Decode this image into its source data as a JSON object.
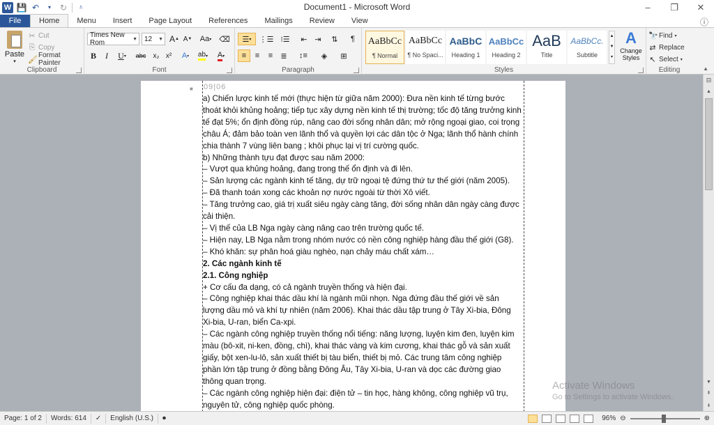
{
  "window": {
    "title": "Document1 - Microsoft Word",
    "app_letter": "W",
    "controls": [
      "–",
      "❐",
      "✕"
    ]
  },
  "tabs": {
    "file": "File",
    "items": [
      "Home",
      "Menu",
      "Insert",
      "Page Layout",
      "References",
      "Mailings",
      "Review",
      "View"
    ],
    "active": "Home"
  },
  "ribbon": {
    "clipboard": {
      "label": "Clipboard",
      "paste": "Paste",
      "cut": "Cut",
      "copy": "Copy",
      "format_painter": "Format Painter"
    },
    "font": {
      "label": "Font",
      "font_name": "Times New Rom",
      "font_size": "12",
      "bold": "B",
      "italic": "I",
      "underline": "U",
      "strike": "abc",
      "subscript": "x₂",
      "superscript": "x²",
      "grow": "A",
      "shrink": "A",
      "change_case": "Aa",
      "text_effects": "A",
      "highlight": "ab",
      "font_color": "A"
    },
    "paragraph": {
      "label": "Paragraph"
    },
    "styles": {
      "label": "Styles",
      "items": [
        {
          "preview": "AaBbCc",
          "name": "¶ Normal"
        },
        {
          "preview": "AaBbCc",
          "name": "¶ No Spaci..."
        },
        {
          "preview": "AaBbC",
          "name": "Heading 1"
        },
        {
          "preview": "AaBbCc",
          "name": "Heading 2"
        },
        {
          "preview": "AaB",
          "name": "Title"
        },
        {
          "preview": "AaBbCc.",
          "name": "Subtitle"
        }
      ],
      "change_styles": "Change Styles"
    },
    "editing": {
      "label": "Editing",
      "find": "Find",
      "replace": "Replace",
      "select": "Select"
    }
  },
  "document": {
    "ruler_marks": "09|06",
    "paragraphs": [
      {
        "text": "a) Chiến lược kinh tế mới (thực hiện từ giữa năm 2000): Đưa nền kinh tế từng bước",
        "bold": false
      },
      {
        "text": "thoát khỏi khủng hoảng; tiếp tục xây dựng nền kinh tế thị trường; tốc độ tăng trưởng kinh",
        "bold": false
      },
      {
        "text": "tế đạt 5%; ổn định đồng rúp, nâng cao đời sống nhân dân; mở rộng ngoại giao, coi trọng",
        "bold": false
      },
      {
        "text": "châu Á; đảm bảo toàn ven lãnh thổ và quyền lợi các dân tộc ở Nga; lãnh thổ hành chính",
        "bold": false
      },
      {
        "text": "chia thành 7 vùng liên bang ; khôi phục lại vị trí cường quốc.",
        "bold": false
      },
      {
        "text": "b) Những thành tựu đạt được sau năm 2000:",
        "bold": false
      },
      {
        "text": "– Vượt qua khủng hoảng, đang trong thế ổn định và đi lên.",
        "bold": false
      },
      {
        "text": "– Sản lượng các ngành kinh tế tăng, dự trữ ngoại tệ đứng thứ tư thế giới (năm 2005).",
        "bold": false
      },
      {
        "text": "– Đã thanh toán xong các khoản nợ nước ngoài từ thời Xô viết.",
        "bold": false
      },
      {
        "text": "– Tăng trưởng cao, giá trị xuất siêu ngày càng tăng, đời sống nhân dân ngày càng được",
        "bold": false
      },
      {
        "text": "cải thiện.",
        "bold": false
      },
      {
        "text": "– Vị thế của LB Nga ngày càng nâng cao trên trường quốc tế.",
        "bold": false
      },
      {
        "text": "– Hiện nay, LB Nga nằm trong nhóm nước có nền công nghiệp hàng đầu thế giới (G8).",
        "bold": false
      },
      {
        "text": "– Khó khăn: sự phân hoá giàu nghèo, nạn chảy máu chất xám…",
        "bold": false
      },
      {
        "text": "2. Các ngành kinh tế",
        "bold": true
      },
      {
        "text": "2.1. Công nghiệp",
        "bold": true
      },
      {
        "text": "+ Cơ cấu đa dạng, có cả ngành truyền thống và hiện đại.",
        "bold": false
      },
      {
        "text": "– Công nghiệp khai thác dầu khí là ngành mũi nhọn. Nga đứng đầu thế giới về sản",
        "bold": false
      },
      {
        "text": "lượng dầu mỏ và khí tự nhiên (năm 2006). Khai thác dầu tập trung ở Tây Xi-bia, Đông",
        "bold": false
      },
      {
        "text": "Xi-bia, U-ran, biển Ca-xpi.",
        "bold": false
      },
      {
        "text": "– Các ngành công nghiệp truyền thống nổi tiếng: năng lượng, luyện kim đen, luyện kim",
        "bold": false
      },
      {
        "text": "màu (bô-xit, ni-ken, đồng, chì), khai thác vàng và kim cương, khai thác gỗ và sản xuất",
        "bold": false
      },
      {
        "text": "giấy, bột xen-lu-lô, sản xuất thiết bị tàu biển, thiết bị mỏ. Các trung tâm công nghiệp",
        "bold": false
      },
      {
        "text": "phần lớn tập trung ở đồng bằng Đông Âu, Tây Xi-bia, U-ran và dọc các đường giao",
        "bold": false
      },
      {
        "text": "thông quan trọng.",
        "bold": false
      },
      {
        "text": "– Các ngành công nghiệp hiện đại: điện tử – tin học, hàng không, công nghiệp vũ trụ,",
        "bold": false
      },
      {
        "text": "nguyên tử, công nghiệp quốc phòng.",
        "bold": false
      }
    ]
  },
  "statusbar": {
    "page": "Page: 1 of 2",
    "words": "Words: 614",
    "language": "English (U.S.)",
    "zoom": "96%",
    "zoom_fraction": 0.48
  },
  "watermark": {
    "line1": "Activate Windows",
    "line2": "Go to Settings to activate Windows."
  },
  "colors": {
    "accent": "#2b579a",
    "selected": "#fcdf98",
    "doc_background": "#acb1b8"
  }
}
